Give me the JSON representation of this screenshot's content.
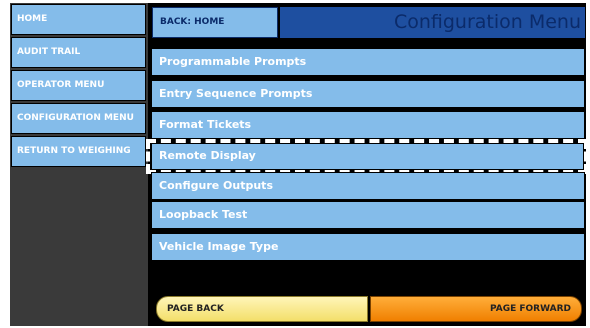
{
  "sidebar": {
    "items": [
      {
        "label": "HOME"
      },
      {
        "label": "AUDIT TRAIL"
      },
      {
        "label": "OPERATOR MENU"
      },
      {
        "label": "CONFIGURATION MENU"
      },
      {
        "label": "RETURN TO WEIGHING"
      }
    ]
  },
  "header": {
    "back_label": "BACK: HOME",
    "title": "Configuration Menu"
  },
  "menu": {
    "items": [
      {
        "label": "Programmable Prompts"
      },
      {
        "label": "Entry Sequence Prompts"
      },
      {
        "label": "Format Tickets"
      },
      {
        "label": "Remote Display"
      },
      {
        "label": "Configure Outputs"
      },
      {
        "label": "Loopback Test"
      },
      {
        "label": "Vehicle Image Type"
      }
    ]
  },
  "footer": {
    "page_back": "PAGE BACK",
    "page_forward": "PAGE FORWARD"
  },
  "colors": {
    "button_blue": "#84bcea",
    "title_bar": "#1e4fa0",
    "page_back": "#f3df6a",
    "page_forward": "#f07f00"
  }
}
